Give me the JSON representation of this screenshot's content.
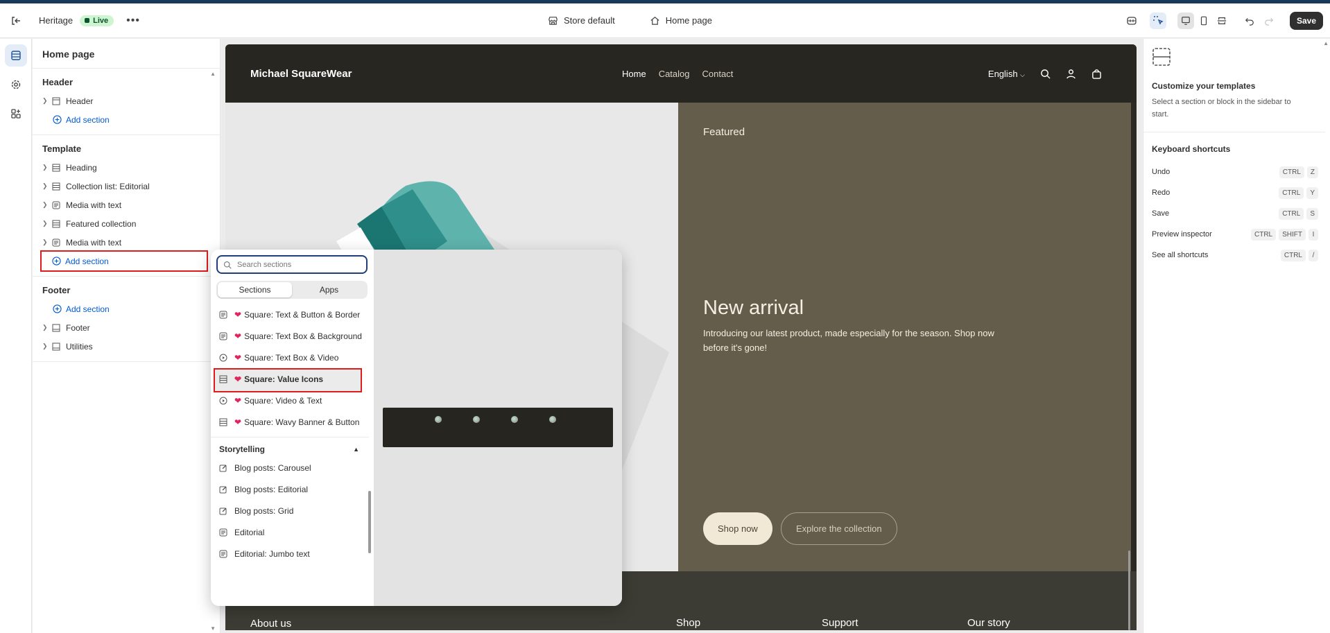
{
  "topbar": {
    "theme_name": "Heritage",
    "live_label": "Live",
    "store_label": "Store default",
    "page_label": "Home page",
    "save_label": "Save"
  },
  "sidebar": {
    "title": "Home page",
    "header_group": {
      "title": "Header",
      "items": [
        "Header"
      ],
      "add_label": "Add section"
    },
    "template_group": {
      "title": "Template",
      "items": [
        "Heading",
        "Collection list: Editorial",
        "Media with text",
        "Featured collection",
        "Media with text"
      ],
      "add_label": "Add section"
    },
    "footer_group": {
      "title": "Footer",
      "add_label": "Add section",
      "items": [
        "Footer",
        "Utilities"
      ]
    }
  },
  "storefront": {
    "brand": "Michael SquareWear",
    "nav": [
      "Home",
      "Catalog",
      "Contact"
    ],
    "language": "English",
    "hero_eyebrow": "Featured",
    "hero_title": "New arrival",
    "hero_desc": "Introducing our latest product, made especially for the season. Shop now before it's gone!",
    "btn_primary": "Shop now",
    "btn_secondary": "Explore the collection",
    "footer_cols": [
      "About us",
      "Shop",
      "Support",
      "Our story"
    ]
  },
  "picker": {
    "search_placeholder": "Search sections",
    "tabs": [
      "Sections",
      "Apps"
    ],
    "items": [
      {
        "label": "Square: Text & Button & Border",
        "icon": "text-icon"
      },
      {
        "label": "Square: Text Box & Background",
        "icon": "text-icon"
      },
      {
        "label": "Square: Text Box & Video",
        "icon": "play-icon"
      },
      {
        "label": "Square: Value Icons",
        "icon": "layout-icon"
      },
      {
        "label": "Square: Video & Text",
        "icon": "play-icon"
      },
      {
        "label": "Square: Wavy Banner & Button",
        "icon": "layout-icon"
      }
    ],
    "category": "Storytelling",
    "category_items": [
      "Blog posts: Carousel",
      "Blog posts: Editorial",
      "Blog posts: Grid",
      "Editorial",
      "Editorial: Jumbo text"
    ]
  },
  "right_panel": {
    "title": "Customize your templates",
    "desc": "Select a section or block in the sidebar to start.",
    "shortcuts_title": "Keyboard shortcuts",
    "shortcuts": [
      {
        "label": "Undo",
        "keys": [
          "CTRL",
          "Z"
        ]
      },
      {
        "label": "Redo",
        "keys": [
          "CTRL",
          "Y"
        ]
      },
      {
        "label": "Save",
        "keys": [
          "CTRL",
          "S"
        ]
      },
      {
        "label": "Preview inspector",
        "keys": [
          "CTRL",
          "SHIFT",
          "I"
        ]
      },
      {
        "label": "See all shortcuts",
        "keys": [
          "CTRL",
          "/"
        ]
      }
    ]
  },
  "colors": {
    "accent": "#005bd3",
    "highlight": "#e01b1b",
    "hero_panel": "#655d4b"
  }
}
